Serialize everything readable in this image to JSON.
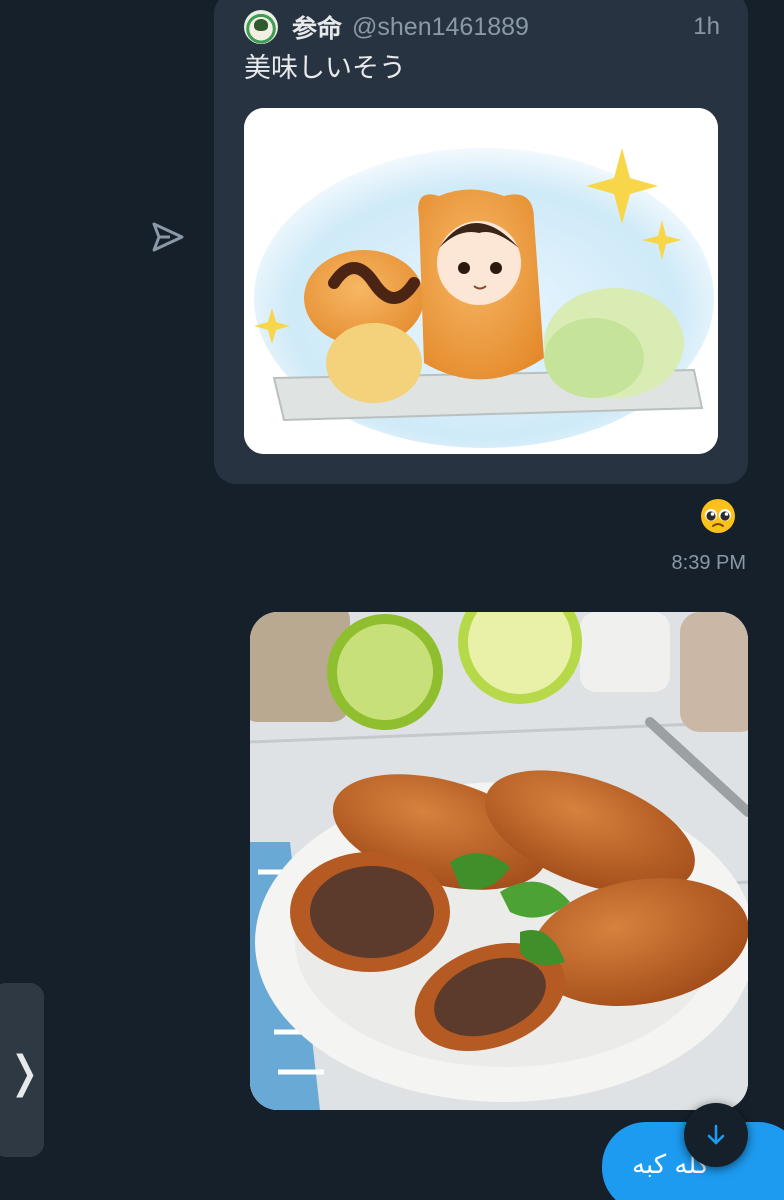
{
  "quoted_tweet": {
    "display_name": "参命",
    "handle": "@shen1461889",
    "time_ago": "1h",
    "text": "美味しいそう",
    "avatar_icon": "anime-avatar",
    "image_description_icon": "illustration-image"
  },
  "icons": {
    "send": "send-icon",
    "reaction": "pleading-face-emoji",
    "scroll_down": "arrow-down-icon",
    "side_handle": "chevron-right-icon"
  },
  "reaction_timestamp": "8:39 PM",
  "outgoing_message": {
    "text": "كله كبه"
  },
  "colors": {
    "background": "#15202b",
    "card": "#273340",
    "accent": "#1d9bf0",
    "secondary_text": "#8b98a5"
  }
}
